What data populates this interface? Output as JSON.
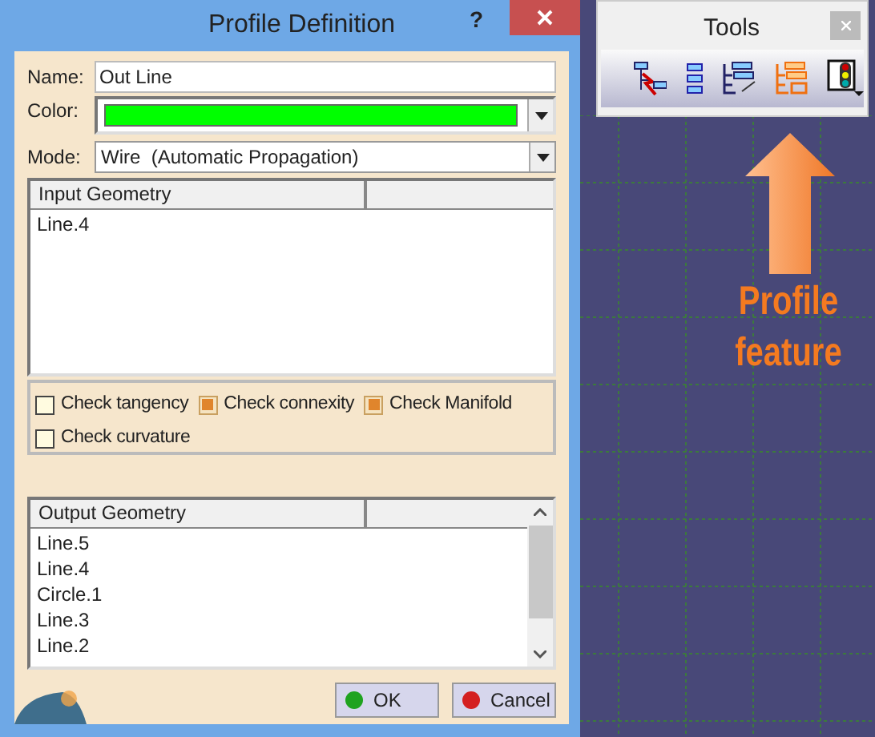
{
  "dialog": {
    "title": "Profile Definition",
    "help": "?",
    "name": {
      "label": "Name:",
      "value": "Out Line"
    },
    "color": {
      "label": "Color:",
      "color": "#00ff00"
    },
    "mode": {
      "label": "Mode:",
      "value": "Wire  (Automatic Propagation)"
    },
    "input_geometry": {
      "columns": [
        "Input Geometry"
      ],
      "rows": [
        "Line.4"
      ]
    },
    "checks": [
      {
        "label": "Check tangency",
        "checked": false
      },
      {
        "label": "Check connexity",
        "checked": true
      },
      {
        "label": "Check Manifold",
        "checked": true
      },
      {
        "label": "Check curvature",
        "checked": false
      }
    ],
    "output_geometry": {
      "columns": [
        "Output Geometry"
      ],
      "rows": [
        "Line.5",
        "Line.4",
        "Circle.1",
        "Line.3",
        "Line.2"
      ]
    },
    "buttons": [
      {
        "label": "OK",
        "kind": "ok"
      },
      {
        "label": "Cancel",
        "kind": "cancel"
      }
    ]
  },
  "tools": {
    "title": "Tools"
  },
  "annotation": {
    "text": "Profile feature"
  }
}
